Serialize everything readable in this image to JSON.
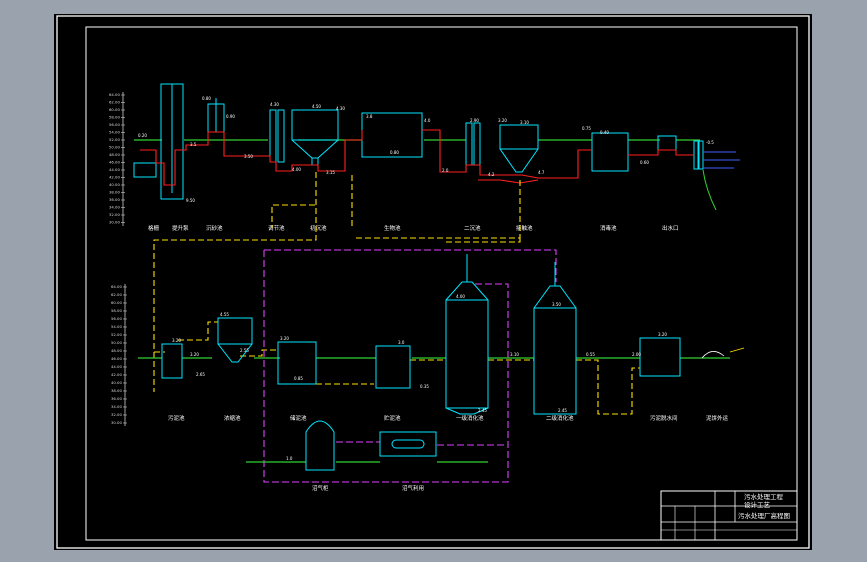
{
  "title_block": {
    "line1": "污水处理工程",
    "line2": "设计工艺",
    "line3": "污水处理厂高程图"
  },
  "stations": {
    "top": [
      "格栅",
      "提升泵",
      "沉砂池",
      "调节池",
      "初沉池",
      "生物池",
      "二沉池",
      "接触池",
      "消毒池",
      "出水口"
    ],
    "bottom": [
      "污泥池",
      "浓缩池",
      "储泥池",
      "贮泥池",
      "一级消化池",
      "二级消化池",
      "污泥脱水间",
      "泥饼外运"
    ],
    "extra": [
      "沼气柜",
      "沼气利用"
    ]
  },
  "elevations": {
    "top": [
      "0.20",
      "9.50",
      "3.5",
      "0.80",
      "0.90",
      "4.30",
      "4.50",
      "4.30",
      "3.50",
      "4.00",
      "3.15",
      "3.8",
      "0.80",
      "4.0",
      "2.0",
      "2.90",
      "3.20",
      "3.10",
      "4.2",
      "4.7",
      "0.75",
      "0.40",
      "0.60",
      "-0.5"
    ],
    "bottom": [
      "3.20",
      "4.55",
      "3.20",
      "2.65",
      "3.20",
      "2.55",
      "0.85",
      "3.0",
      "0.35",
      "4.00",
      "3.10",
      "2.45",
      "3.50",
      "2.45",
      "0.55",
      "3.20",
      "2.00",
      "1.0"
    ],
    "scale_top": [
      "64.00",
      "62.00",
      "60.00",
      "58.00",
      "56.00",
      "54.00",
      "52.00",
      "50.00",
      "48.00",
      "46.00",
      "44.00",
      "42.00",
      "40.00",
      "38.00",
      "36.00",
      "34.00",
      "32.00",
      "30.00"
    ],
    "scale_bottom": [
      "64.00",
      "62.00",
      "60.00",
      "58.00",
      "56.00",
      "54.00",
      "52.00",
      "50.00",
      "48.00",
      "46.00",
      "44.00",
      "42.00",
      "40.00",
      "38.00",
      "36.00",
      "34.00",
      "32.00",
      "30.00"
    ]
  },
  "colors": {
    "sheet_bg": "#000000",
    "frame": "#ffffff",
    "cyan": "#00e5ff",
    "red": "#ff2020",
    "yellow": "#ffe000",
    "magenta": "#e040ff",
    "green": "#30d030",
    "white": "#ffffff",
    "blue": "#4060ff"
  }
}
